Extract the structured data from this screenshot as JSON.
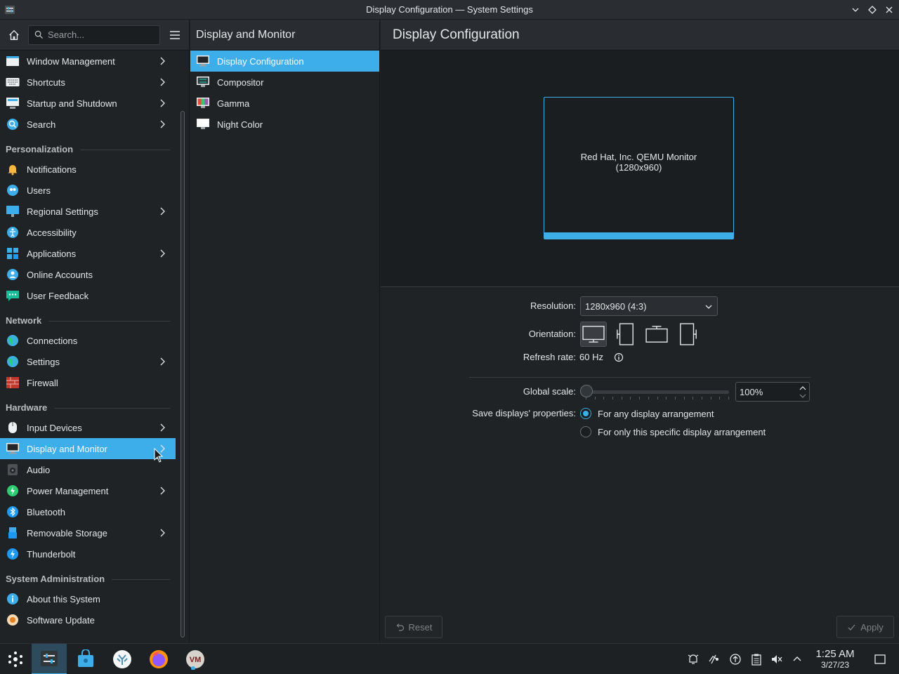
{
  "window": {
    "title": "Display Configuration — System Settings"
  },
  "sidebar": {
    "search_placeholder": "Search...",
    "groups": [
      {
        "header": "",
        "items": [
          {
            "label": "Window Management",
            "icon": "window-management-icon",
            "chevron": true
          },
          {
            "label": "Shortcuts",
            "icon": "keyboard-icon",
            "chevron": true
          },
          {
            "label": "Startup and Shutdown",
            "icon": "startup-icon",
            "chevron": true
          },
          {
            "label": "Search",
            "icon": "search-icon",
            "chevron": true
          }
        ]
      },
      {
        "header": "Personalization",
        "items": [
          {
            "label": "Notifications",
            "icon": "bell-icon",
            "chevron": false
          },
          {
            "label": "Users",
            "icon": "users-icon",
            "chevron": false
          },
          {
            "label": "Regional Settings",
            "icon": "regional-icon",
            "chevron": true
          },
          {
            "label": "Accessibility",
            "icon": "accessibility-icon",
            "chevron": false
          },
          {
            "label": "Applications",
            "icon": "applications-icon",
            "chevron": true
          },
          {
            "label": "Online Accounts",
            "icon": "online-accounts-icon",
            "chevron": false
          },
          {
            "label": "User Feedback",
            "icon": "feedback-icon",
            "chevron": false
          }
        ]
      },
      {
        "header": "Network",
        "items": [
          {
            "label": "Connections",
            "icon": "globe-icon",
            "chevron": false
          },
          {
            "label": "Settings",
            "icon": "globe-icon",
            "chevron": true
          },
          {
            "label": "Firewall",
            "icon": "firewall-icon",
            "chevron": false
          }
        ]
      },
      {
        "header": "Hardware",
        "items": [
          {
            "label": "Input Devices",
            "icon": "mouse-icon",
            "chevron": true
          },
          {
            "label": "Display and Monitor",
            "icon": "monitor-icon",
            "chevron": true,
            "selected": true
          },
          {
            "label": "Audio",
            "icon": "speaker-icon",
            "chevron": false
          },
          {
            "label": "Power Management",
            "icon": "power-icon",
            "chevron": true
          },
          {
            "label": "Bluetooth",
            "icon": "bluetooth-icon",
            "chevron": false
          },
          {
            "label": "Removable Storage",
            "icon": "usb-icon",
            "chevron": true
          },
          {
            "label": "Thunderbolt",
            "icon": "thunderbolt-icon",
            "chevron": false
          }
        ]
      },
      {
        "header": "System Administration",
        "items": [
          {
            "label": "About this System",
            "icon": "info-icon",
            "chevron": false
          },
          {
            "label": "Software Update",
            "icon": "update-icon",
            "chevron": false
          }
        ]
      }
    ]
  },
  "midpane": {
    "title": "Display and Monitor",
    "items": [
      {
        "label": "Display Configuration",
        "icon": "monitor-icon",
        "selected": true
      },
      {
        "label": "Compositor",
        "icon": "compositor-icon",
        "selected": false
      },
      {
        "label": "Gamma",
        "icon": "gamma-icon",
        "selected": false
      },
      {
        "label": "Night Color",
        "icon": "night-color-icon",
        "selected": false
      }
    ]
  },
  "content": {
    "title": "Display Configuration",
    "monitor": {
      "name": "Red Hat, Inc. QEMU Monitor",
      "resolution": "(1280x960)"
    },
    "resolution_label": "Resolution:",
    "resolution_value": "1280x960 (4:3)",
    "orientation_label": "Orientation:",
    "refresh_label": "Refresh rate:",
    "refresh_value": "60 Hz",
    "scale_label": "Global scale:",
    "scale_value": "100%",
    "scale_level": 0,
    "save_label": "Save displays' properties:",
    "radio_any": "For any display arrangement",
    "radio_specific": "For only this specific display arrangement",
    "reset_label": "Reset",
    "apply_label": "Apply"
  },
  "taskbar": {
    "time": "1:25 AM",
    "date": "3/27/23"
  },
  "colors": {
    "accent": "#3daee9",
    "background": "#202326"
  }
}
